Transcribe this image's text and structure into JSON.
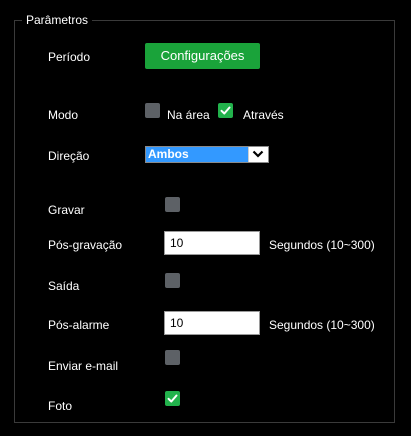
{
  "section": {
    "title": "Parâmetros"
  },
  "periodo": {
    "label": "Período",
    "button_label": "Configurações"
  },
  "modo": {
    "label": "Modo",
    "option_na_area": {
      "label": "Na área",
      "checked": false
    },
    "option_atraves": {
      "label": "Através",
      "checked": true
    }
  },
  "direcao": {
    "label": "Direção",
    "selected": "Ambos"
  },
  "gravar": {
    "label": "Gravar",
    "checked": false
  },
  "pos_gravacao": {
    "label": "Pós-gravação",
    "value": "10",
    "unit": "Segundos (10~300)"
  },
  "saida": {
    "label": "Saída",
    "checked": false
  },
  "pos_alarme": {
    "label": "Pós-alarme",
    "value": "10",
    "unit": "Segundos (10~300)"
  },
  "enviar_email": {
    "label": "Enviar e-mail",
    "checked": false
  },
  "foto": {
    "label": "Foto",
    "checked": true
  },
  "colors": {
    "accent_green": "#22b24c",
    "button_green": "#1aa33a",
    "select_highlight": "#3399ff",
    "checkbox_off": "#5d6166",
    "background": "#000000"
  },
  "icons": {
    "checkmark": "check-icon",
    "dropdown": "chevron-down-icon"
  }
}
